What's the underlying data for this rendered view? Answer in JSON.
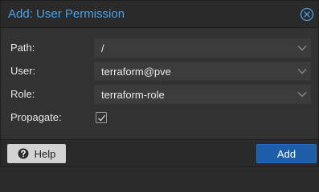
{
  "dialog": {
    "title": "Add: User Permission",
    "close_icon": "close-circle-icon",
    "accent_color": "#4ea1e6"
  },
  "form": {
    "path": {
      "label": "Path:",
      "value": "/"
    },
    "user": {
      "label": "User:",
      "value": "terraform@pve"
    },
    "role": {
      "label": "Role:",
      "value": "terraform-role"
    },
    "propagate": {
      "label": "Propagate:",
      "checked": true
    }
  },
  "footer": {
    "help_label": "Help",
    "help_icon": "question-circle-icon",
    "add_label": "Add",
    "add_color": "#1c5fa8"
  }
}
